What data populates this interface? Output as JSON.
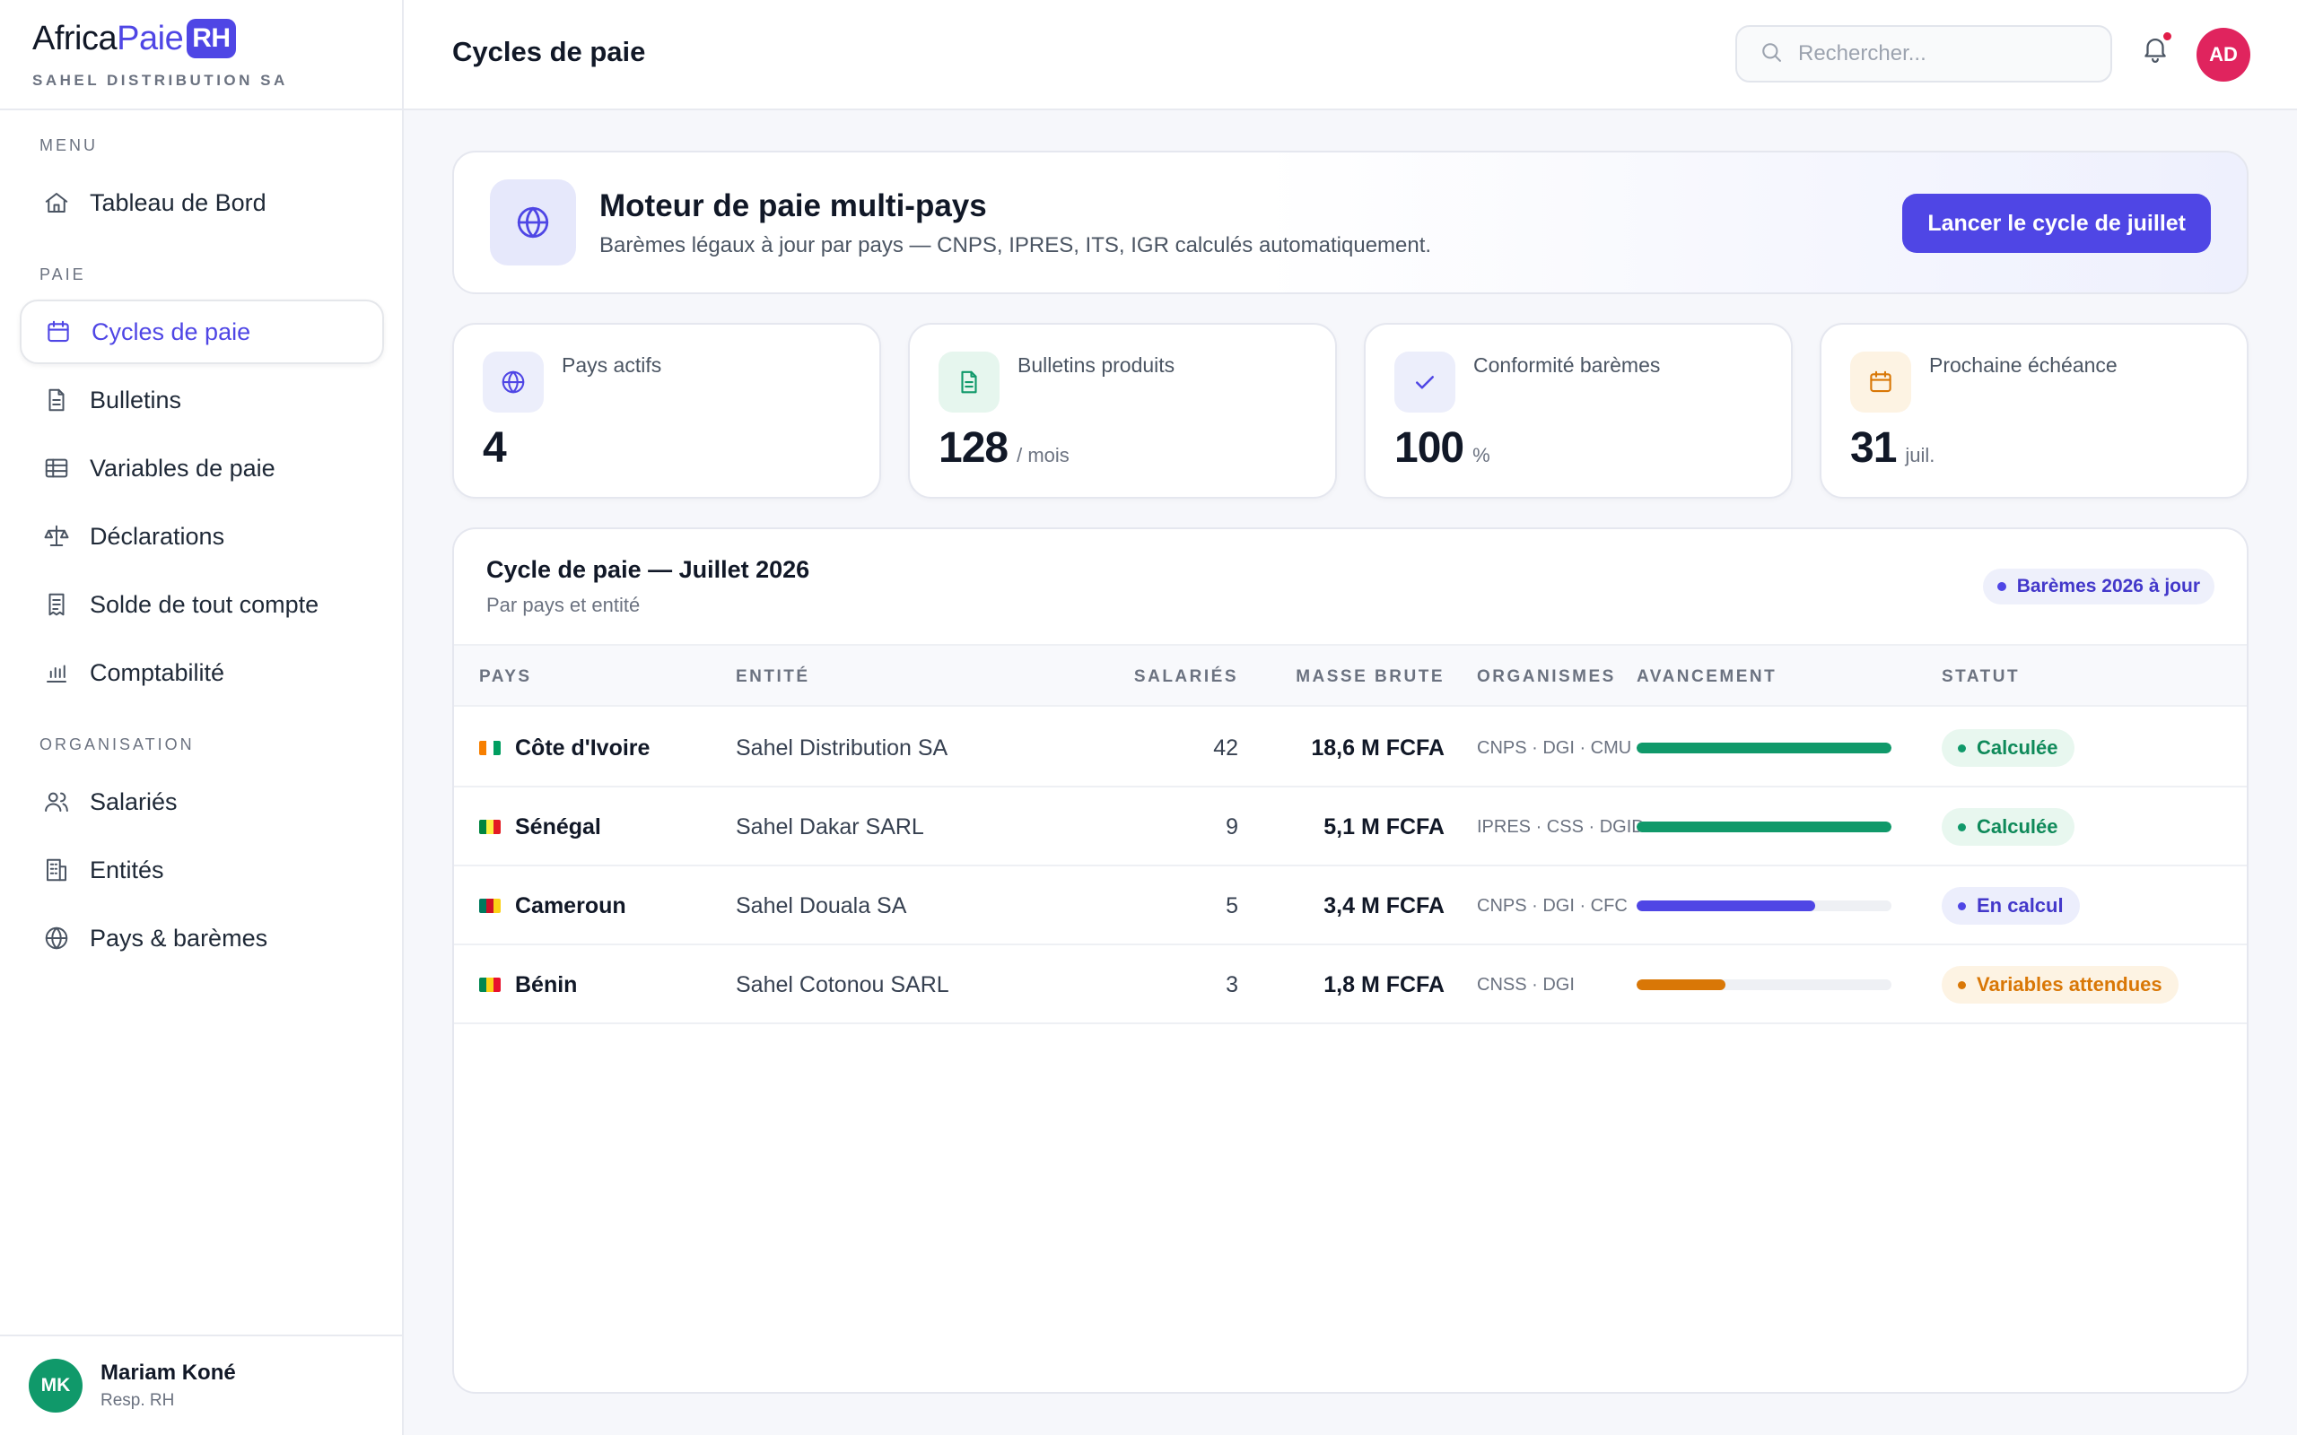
{
  "brand": {
    "logo_part1": "Africa",
    "logo_part2": "Paie",
    "logo_badge": "RH",
    "company": "SAHEL DISTRIBUTION SA"
  },
  "sidebar": {
    "section_menu": "MENU",
    "section_paie": "PAIE",
    "section_org": "ORGANISATION",
    "items": [
      {
        "label": "Tableau de Bord",
        "icon": "home-icon"
      },
      {
        "label": "Cycles de paie",
        "icon": "calendar-icon",
        "active": true
      },
      {
        "label": "Bulletins",
        "icon": "document-icon"
      },
      {
        "label": "Variables de paie",
        "icon": "table-icon"
      },
      {
        "label": "Déclarations",
        "icon": "scale-icon"
      },
      {
        "label": "Solde de tout compte",
        "icon": "receipt-icon"
      },
      {
        "label": "Comptabilité",
        "icon": "bar-chart-icon"
      },
      {
        "label": "Salariés",
        "icon": "users-icon"
      },
      {
        "label": "Entités",
        "icon": "building-icon"
      },
      {
        "label": "Pays & barèmes",
        "icon": "globe-icon"
      }
    ],
    "user": {
      "initials": "MK",
      "name": "Mariam Koné",
      "role": "Resp. RH"
    }
  },
  "header": {
    "title": "Cycles de paie",
    "search_placeholder": "Rechercher...",
    "avatar_initials": "AD"
  },
  "hero": {
    "title": "Moteur de paie multi-pays",
    "subtitle": "Barèmes légaux à jour par pays — CNPS, IPRES, ITS, IGR calculés automatiquement.",
    "button": "Lancer le cycle de juillet"
  },
  "stats": [
    {
      "label": "Pays actifs",
      "value": "4",
      "unit": "",
      "icon": "globe-icon"
    },
    {
      "label": "Bulletins produits",
      "value": "128",
      "unit": "/ mois",
      "icon": "document-icon"
    },
    {
      "label": "Conformité barèmes",
      "value": "100",
      "unit": "%",
      "icon": "check-icon"
    },
    {
      "label": "Prochaine échéance",
      "value": "31",
      "unit": "juil.",
      "icon": "calendar-icon"
    }
  ],
  "table": {
    "title": "Cycle de paie — Juillet 2026",
    "subtitle": "Par pays et entité",
    "badge": "Barèmes 2026 à jour",
    "headers": [
      "PAYS",
      "ENTITÉ",
      "SALARIÉS",
      "MASSE BRUTE",
      "ORGANISMES",
      "AVANCEMENT",
      "STATUT"
    ],
    "rows": [
      {
        "country": "Côte d'Ivoire",
        "entity": "Sahel Distribution SA",
        "employees": "42",
        "mass": "18,6 M FCFA",
        "orgs": "CNPS · DGI · CMU",
        "progress": 1.0,
        "bar_color": "#10996a",
        "status": "Calculée",
        "status_kind": "green",
        "flag": [
          "#f77f00",
          "#ffffff",
          "#009e60"
        ]
      },
      {
        "country": "Sénégal",
        "entity": "Sahel Dakar SARL",
        "employees": "9",
        "mass": "5,1 M FCFA",
        "orgs": "IPRES · CSS · DGID",
        "progress": 1.0,
        "bar_color": "#10996a",
        "status": "Calculée",
        "status_kind": "green",
        "flag": [
          "#00853f",
          "#fdef42",
          "#e31b23"
        ]
      },
      {
        "country": "Cameroun",
        "entity": "Sahel Douala SA",
        "employees": "5",
        "mass": "3,4 M FCFA",
        "orgs": "CNPS · DGI · CFC",
        "progress": 0.7,
        "bar_color": "#4f46e5",
        "status": "En calcul",
        "status_kind": "blue",
        "flag": [
          "#007a5e",
          "#ce1126",
          "#fcd116"
        ]
      },
      {
        "country": "Bénin",
        "entity": "Sahel Cotonou SARL",
        "employees": "3",
        "mass": "1,8 M FCFA",
        "orgs": "CNSS · DGI",
        "progress": 0.35,
        "bar_color": "#d97706",
        "status": "Variables attendues",
        "status_kind": "orange",
        "flag": [
          "#008751",
          "#fcd116",
          "#e8112d"
        ]
      }
    ]
  }
}
